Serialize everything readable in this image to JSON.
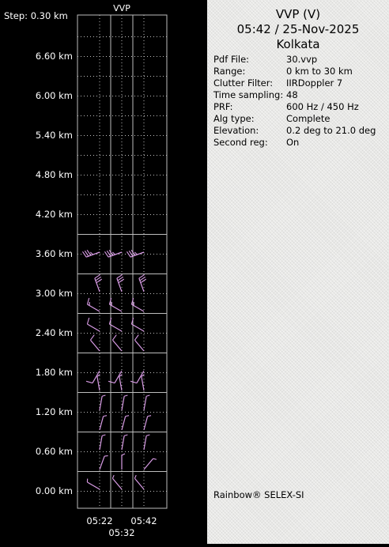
{
  "header": {
    "title": "VVP (V)",
    "datetime": "05:42 / 25-Nov-2025",
    "location": "Kolkata"
  },
  "info": [
    {
      "key": "Pdf File:",
      "value": "30.vvp"
    },
    {
      "key": "Range:",
      "value": "0 km to 30 km"
    },
    {
      "key": "Clutter Filter:",
      "value": "IIRDoppler 7"
    },
    {
      "key": "Time sampling:",
      "value": "48"
    },
    {
      "key": "PRF:",
      "value": "600 Hz / 450 Hz"
    },
    {
      "key": "Alg type:",
      "value": "Complete"
    },
    {
      "key": "Elevation:",
      "value": "0.2 deg to 21.0 deg"
    },
    {
      "key": "Second reg:",
      "value": "On"
    }
  ],
  "brand": "Rainbow® SELEX-SI",
  "colors": {
    "background": "#000000",
    "panel": "#e8e8e6",
    "grid": "#bdbdbd",
    "barbs": "#d99ce6"
  },
  "chart_data": {
    "type": "wind-barb-profile",
    "title": "VVP",
    "step_label": "Step: 0.30 km",
    "ylim": [
      0,
      7.2
    ],
    "y_ticks": [
      "0.00 km",
      "0.60 km",
      "1.20 km",
      "1.80 km",
      "2.40 km",
      "3.00 km",
      "3.60 km",
      "4.20 km",
      "4.80 km",
      "5.40 km",
      "6.00 km",
      "6.60 km"
    ],
    "x_ticks": [
      "05:22",
      "05:42"
    ],
    "x_tick_mid": "05:32",
    "times": [
      "05:22",
      "05:32",
      "05:42"
    ],
    "data_top_km": 3.9,
    "barb_heights_km": [
      0.0,
      0.3,
      0.6,
      0.9,
      1.2,
      1.5,
      1.8,
      2.1,
      2.4,
      2.7,
      3.0,
      3.6
    ],
    "wind_dir_deg": [
      [
        300,
        320,
        320
      ],
      [
        20,
        0,
        40
      ],
      [
        10,
        10,
        10
      ],
      [
        15,
        15,
        15
      ],
      [
        10,
        10,
        10
      ],
      [
        350,
        350,
        350
      ],
      [
        210,
        210,
        210
      ],
      [
        320,
        320,
        320
      ],
      [
        300,
        300,
        300
      ],
      [
        300,
        300,
        300
      ],
      [
        340,
        340,
        340
      ],
      [
        250,
        250,
        250
      ]
    ],
    "wind_speed_kt": [
      [
        5,
        5,
        5
      ],
      [
        5,
        5,
        5
      ],
      [
        5,
        5,
        5
      ],
      [
        5,
        5,
        5
      ],
      [
        5,
        5,
        5
      ],
      [
        5,
        5,
        5
      ],
      [
        10,
        10,
        10
      ],
      [
        10,
        10,
        10
      ],
      [
        10,
        10,
        10
      ],
      [
        15,
        15,
        15
      ],
      [
        30,
        30,
        30
      ],
      [
        35,
        35,
        35
      ]
    ]
  }
}
